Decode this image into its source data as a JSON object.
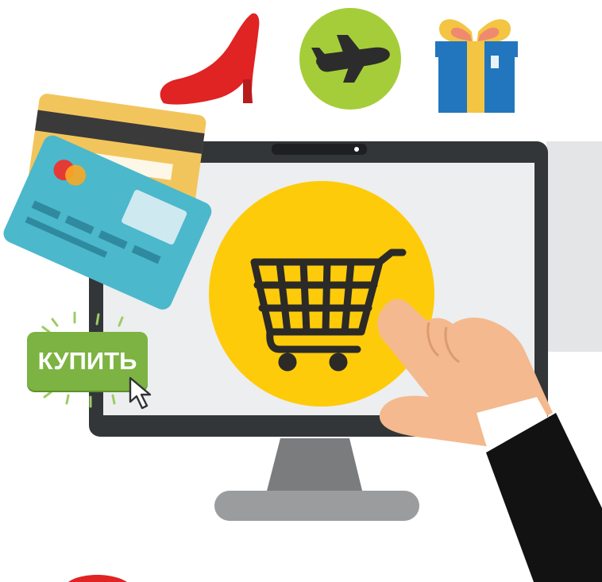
{
  "buy_button": {
    "label": "КУПИТЬ"
  },
  "colors": {
    "button_green": "#7cb342",
    "cart_circle_yellow": "#fecb0a",
    "plane_circle_green": "#a5cd39",
    "shoe_red": "#e02323",
    "gift_blue": "#2176bd",
    "gift_ribbon": "#f3c542",
    "card_teal": "#4bb8cc",
    "card_gold": "#f2c55c",
    "monitor_dark": "#333638",
    "screen_gray": "#eceeef",
    "skin": "#f4b98e",
    "sleeve_black": "#121212"
  },
  "icons": [
    "high-heel-shoe-icon",
    "airplane-icon",
    "gift-box-icon",
    "credit-card-icon",
    "shopping-cart-icon",
    "mouse-cursor-icon",
    "pointing-hand-icon",
    "monitor-icon"
  ]
}
